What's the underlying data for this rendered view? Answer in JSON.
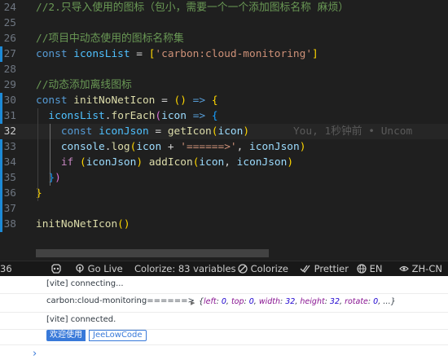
{
  "editor": {
    "lines": [
      {
        "n": "24",
        "cur": false,
        "tokens": [
          [
            "cm",
            "//2.只导入使用的图标（包小，需要一个一个添加图标名称 麻烦）"
          ]
        ]
      },
      {
        "n": "25",
        "cur": false,
        "tokens": []
      },
      {
        "n": "26",
        "cur": false,
        "tokens": [
          [
            "cm",
            "//项目中动态使用的图标名称集"
          ]
        ]
      },
      {
        "n": "27",
        "cur": false,
        "tokens": [
          [
            "kw",
            "const "
          ],
          [
            "cst",
            "iconsList"
          ],
          [
            "op",
            " = "
          ],
          [
            "b1",
            "["
          ],
          [
            "str",
            "'carbon:cloud-monitoring'"
          ],
          [
            "b1",
            "]"
          ]
        ]
      },
      {
        "n": "28",
        "cur": false,
        "tokens": []
      },
      {
        "n": "29",
        "cur": false,
        "tokens": [
          [
            "cm",
            "//动态添加离线图标"
          ]
        ]
      },
      {
        "n": "30",
        "cur": false,
        "tokens": [
          [
            "kw",
            "const "
          ],
          [
            "fn",
            "initNoNetIcon"
          ],
          [
            "op",
            " = "
          ],
          [
            "b1",
            "()"
          ],
          [
            "op",
            " "
          ],
          [
            "kw",
            "=>"
          ],
          [
            "op",
            " "
          ],
          [
            "b1",
            "{"
          ]
        ]
      },
      {
        "n": "31",
        "cur": false,
        "tokens": [
          [
            "op",
            "  "
          ],
          [
            "cst",
            "iconsList"
          ],
          [
            "op",
            "."
          ],
          [
            "fn",
            "forEach"
          ],
          [
            "b2",
            "("
          ],
          [
            "var",
            "icon"
          ],
          [
            "op",
            " "
          ],
          [
            "kw",
            "=>"
          ],
          [
            "op",
            " "
          ],
          [
            "b3",
            "{"
          ]
        ]
      },
      {
        "n": "32",
        "cur": true,
        "tokens": [
          [
            "op",
            "    "
          ],
          [
            "kw",
            "const "
          ],
          [
            "cst",
            "iconJson"
          ],
          [
            "op",
            " = "
          ],
          [
            "fn",
            "getIcon"
          ],
          [
            "b1",
            "("
          ],
          [
            "var",
            "icon"
          ],
          [
            "b1",
            ")"
          ],
          [
            "op",
            "       "
          ],
          [
            "blame",
            "You, 1秒钟前 • Uncom"
          ]
        ]
      },
      {
        "n": "33",
        "cur": false,
        "tokens": [
          [
            "op",
            "    "
          ],
          [
            "var",
            "console"
          ],
          [
            "op",
            "."
          ],
          [
            "fn",
            "log"
          ],
          [
            "b1",
            "("
          ],
          [
            "var",
            "icon"
          ],
          [
            "op",
            " + "
          ],
          [
            "str",
            "'======>'"
          ],
          [
            "op",
            ", "
          ],
          [
            "var",
            "iconJson"
          ],
          [
            "b1",
            ")"
          ]
        ]
      },
      {
        "n": "34",
        "cur": false,
        "tokens": [
          [
            "op",
            "    "
          ],
          [
            "ctl",
            "if"
          ],
          [
            "op",
            " "
          ],
          [
            "b1",
            "("
          ],
          [
            "var",
            "iconJson"
          ],
          [
            "b1",
            ")"
          ],
          [
            "op",
            " "
          ],
          [
            "fn",
            "addIcon"
          ],
          [
            "b1",
            "("
          ],
          [
            "var",
            "icon"
          ],
          [
            "op",
            ", "
          ],
          [
            "var",
            "iconJson"
          ],
          [
            "b1",
            ")"
          ]
        ]
      },
      {
        "n": "35",
        "cur": false,
        "tokens": [
          [
            "op",
            "  "
          ],
          [
            "b3",
            "}"
          ],
          [
            "b2",
            ")"
          ]
        ]
      },
      {
        "n": "36",
        "cur": false,
        "tokens": [
          [
            "b1",
            "}"
          ]
        ]
      },
      {
        "n": "37",
        "cur": false,
        "tokens": []
      },
      {
        "n": "38",
        "cur": false,
        "tokens": [
          [
            "fn",
            "initNoNetIcon"
          ],
          [
            "b1",
            "()"
          ]
        ]
      }
    ]
  },
  "statusbar": {
    "line_col": "36",
    "go_live": "Go Live",
    "colorize_vars": "Colorize: 83 variables",
    "colorize": "Colorize",
    "prettier": "Prettier",
    "lang1": "EN",
    "lang2": "ZH-CN"
  },
  "console": {
    "msg1": "[vite] connecting...",
    "msg2_text": "carbon:cloud-monitoring======>",
    "msg2_obj": {
      "left": "0",
      "top": "0",
      "width": "32",
      "height": "32",
      "rotate": "0"
    },
    "msg3": "[vite] connected.",
    "tag_welcome": "欢迎使用",
    "tag_brand": "JeeLowCode",
    "prompt": "›"
  }
}
